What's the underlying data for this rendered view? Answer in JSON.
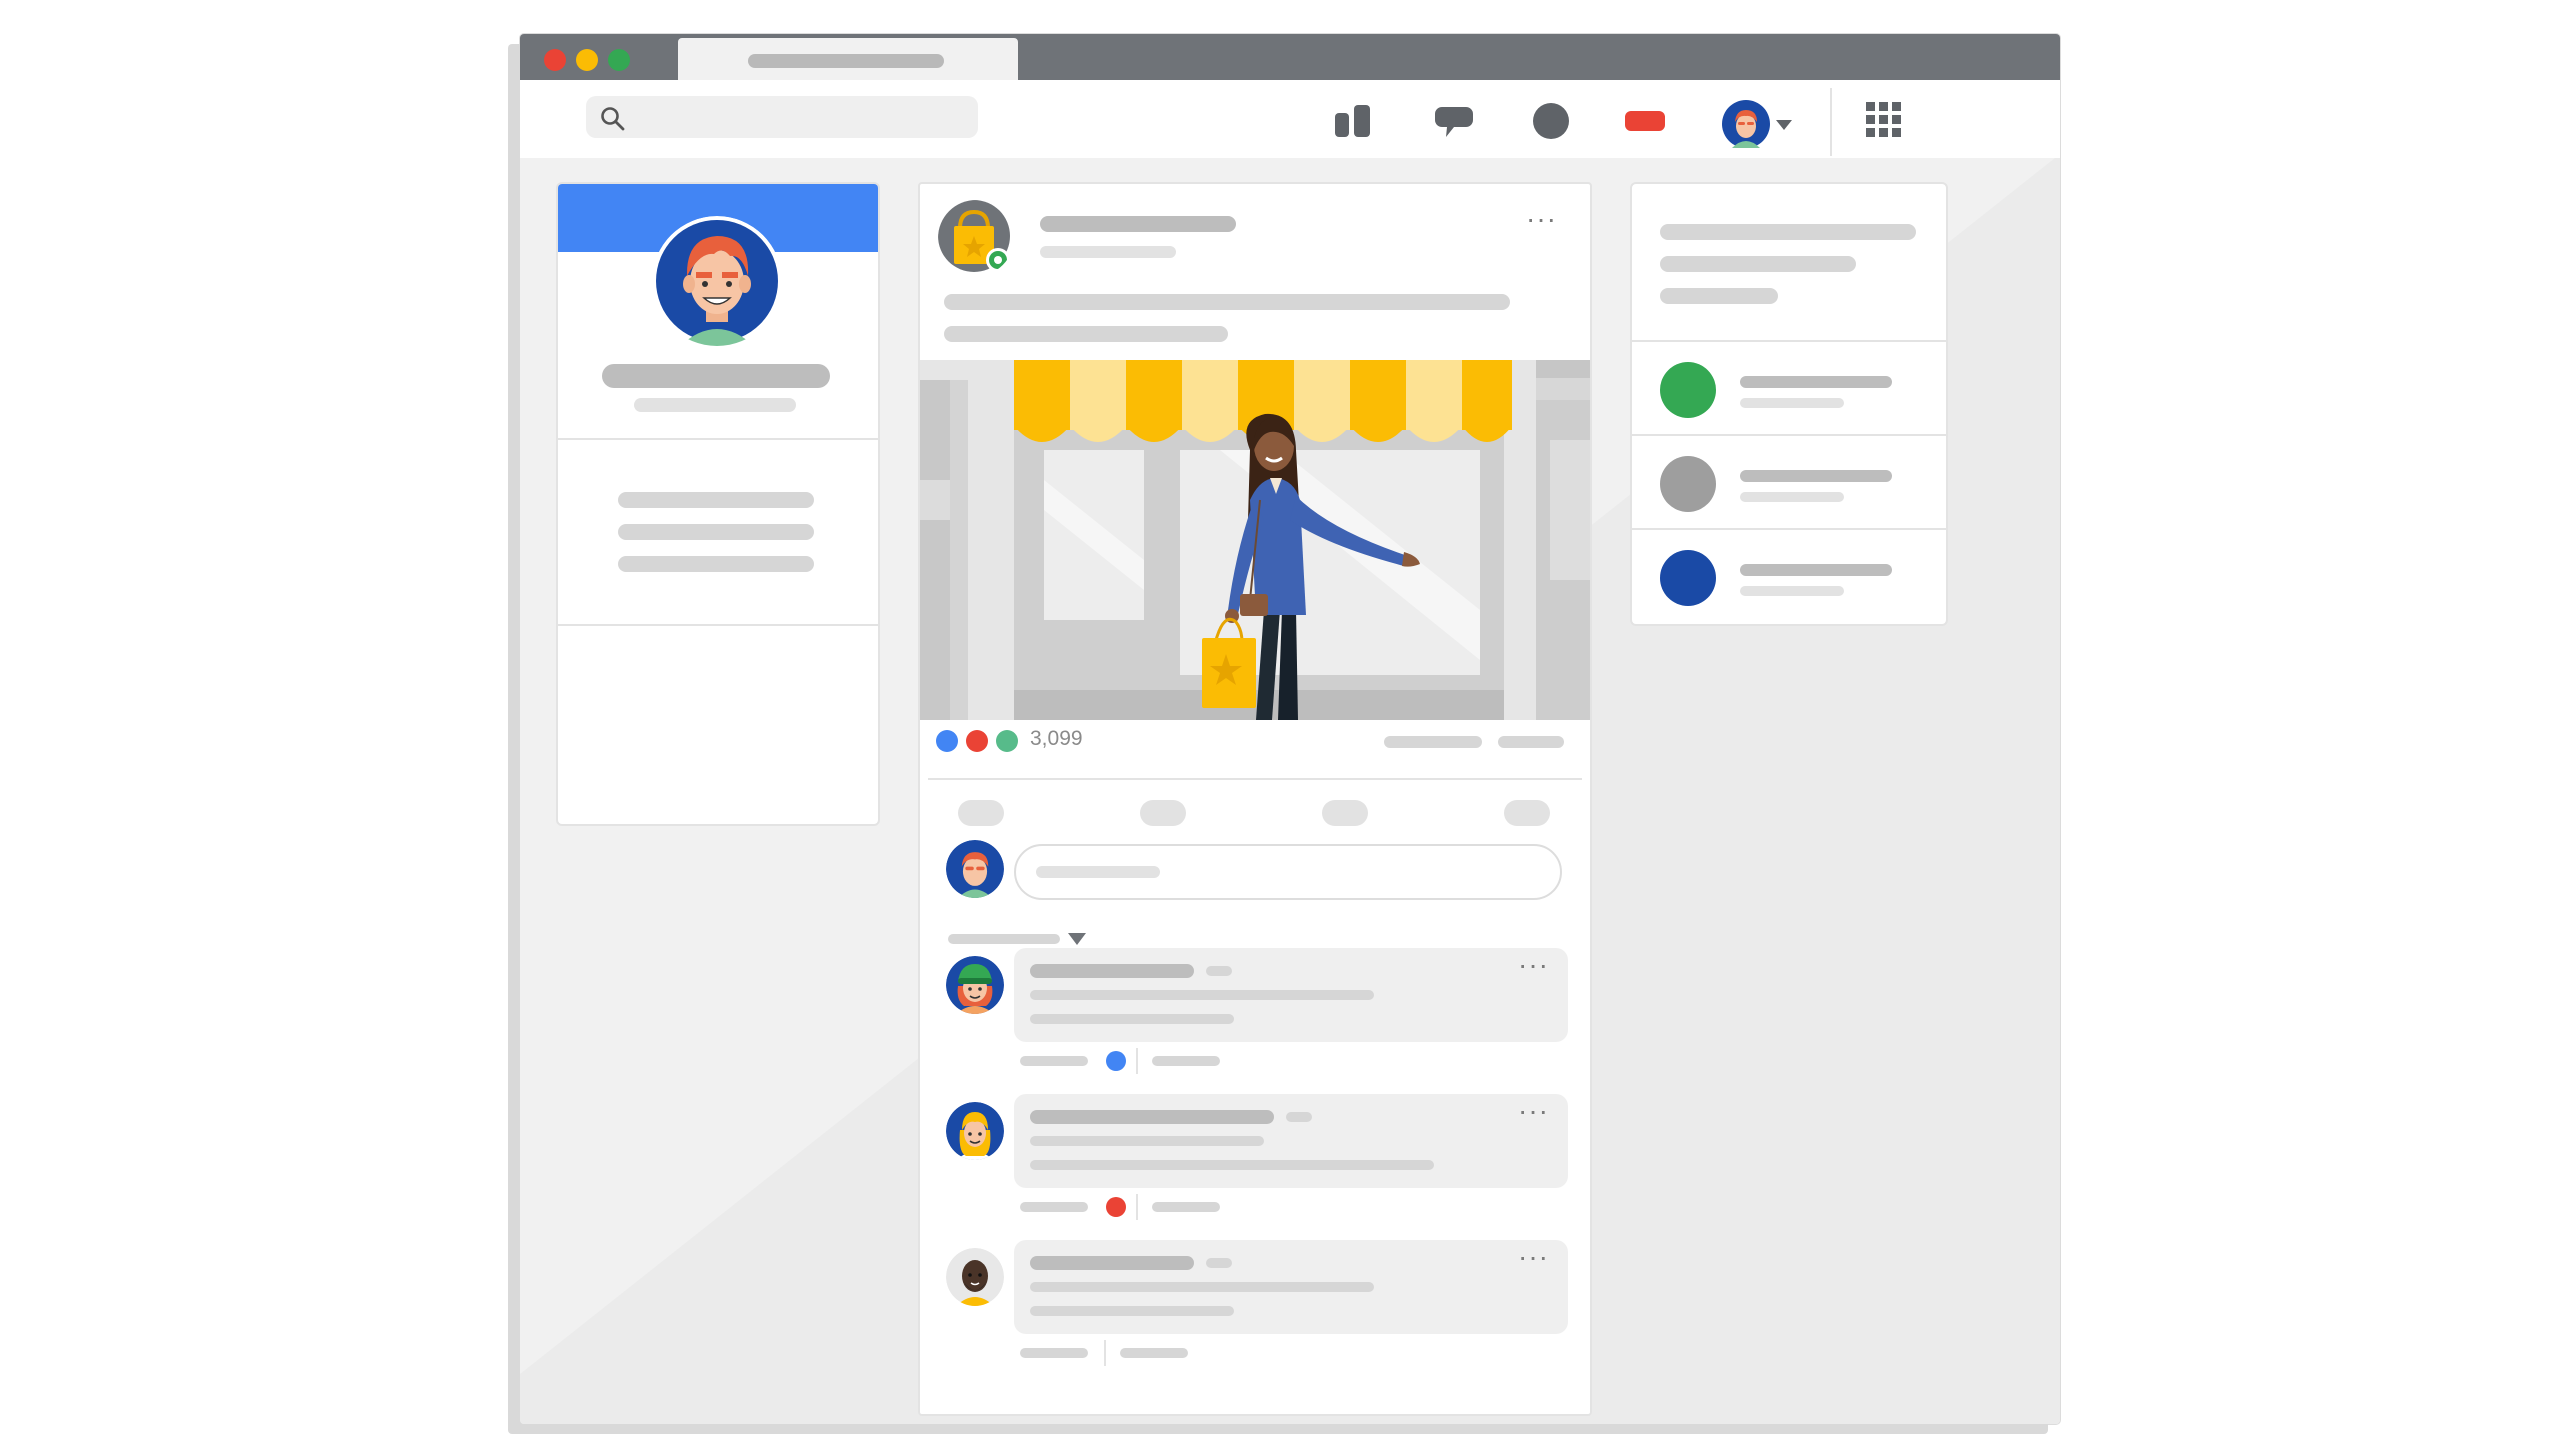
{
  "colors": {
    "blue": "#4285f4",
    "red": "#ea4335",
    "yellow": "#fbbc04",
    "green": "#34a853",
    "dark_blue": "#1a4aa6",
    "grey": "#9e9e9e"
  },
  "window_controls": [
    "close",
    "minimize",
    "maximize"
  ],
  "top_nav": {
    "icons": [
      "search-icon",
      "boards-icon",
      "chat-icon",
      "notifications-icon",
      "video-icon",
      "avatar",
      "apps-grid-icon"
    ]
  },
  "post": {
    "reaction_colors": [
      "#4285f4",
      "#ea4335",
      "#57bb8a"
    ],
    "reaction_count": "3,099",
    "more_label": "···"
  },
  "suggestions": {
    "item_colors": [
      "#34a853",
      "#9e9e9e",
      "#1a4aa6"
    ]
  },
  "comments": {
    "reaction_colors": [
      "#4285f4",
      "#ea4335",
      ""
    ]
  }
}
